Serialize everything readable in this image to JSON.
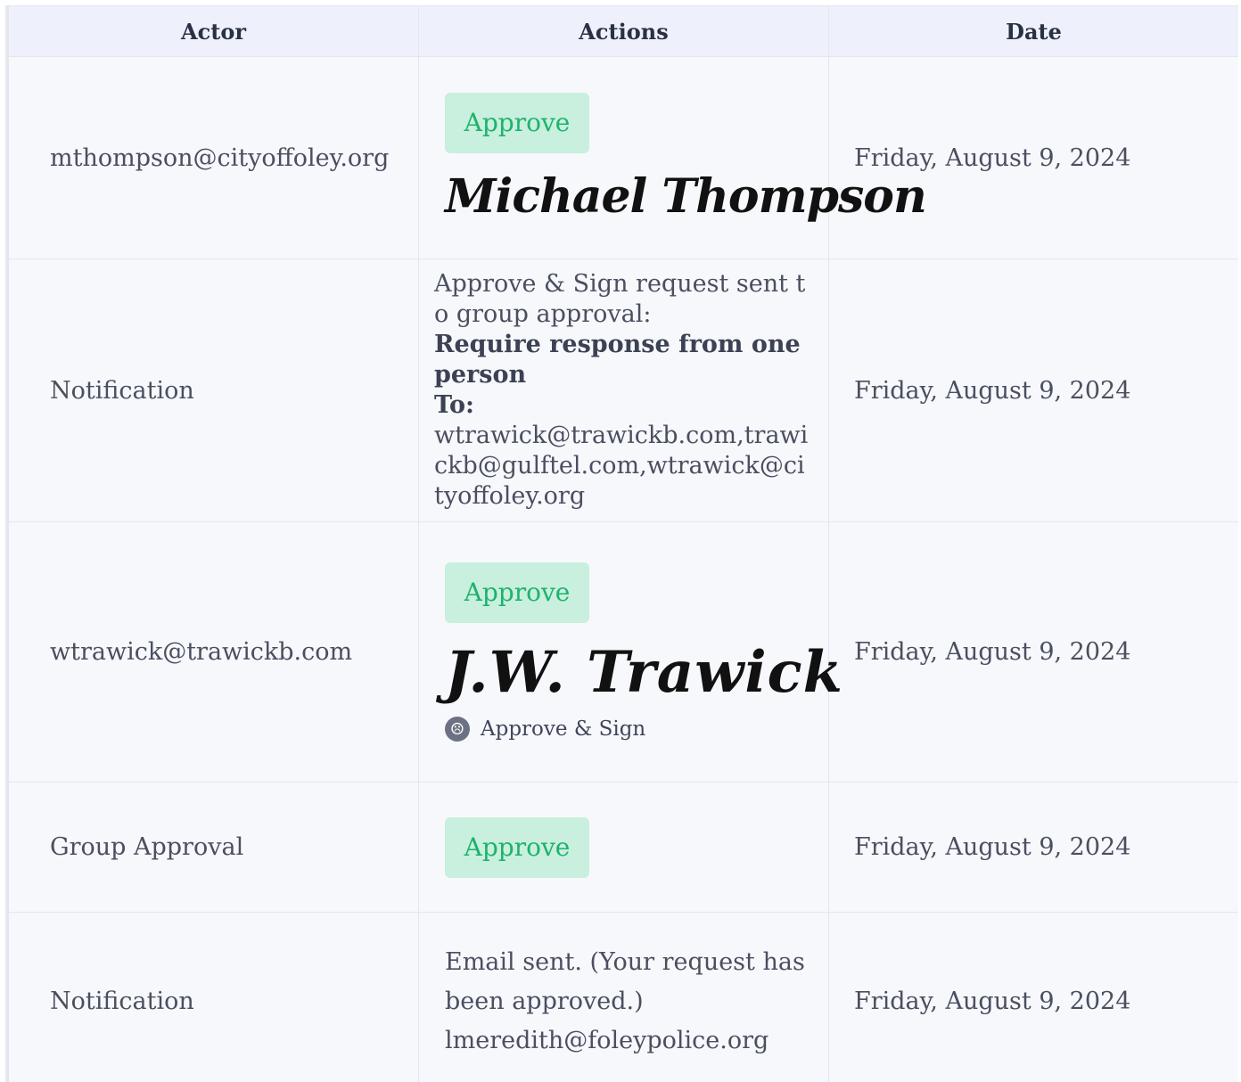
{
  "columns": {
    "actor": "Actor",
    "actions": "Actions",
    "date": "Date"
  },
  "rows": [
    {
      "actor": "mthompson@cityoffoley.org",
      "approve_label": "Approve",
      "signature": "Michael Thompson",
      "date": "Friday, August 9, 2024"
    },
    {
      "actor": "Notification",
      "message_line": "Approve & Sign request sent to group approval:",
      "requirement": "Require response from one person",
      "to_label": "To:",
      "recipients": "wtrawick@trawickb.com,trawickb@gulftel.com,wtrawick@cityoffoley.org",
      "date": "Friday, August 9, 2024"
    },
    {
      "actor": "wtrawick@trawickb.com",
      "approve_label": "Approve",
      "signature": "J.W. Trawick",
      "sub_action": "Approve & Sign",
      "date": "Friday, August 9, 2024"
    },
    {
      "actor": "Group Approval",
      "approve_label": "Approve",
      "date": "Friday, August 9, 2024"
    },
    {
      "actor": "Notification",
      "email_status": "Email sent. (Your request has been approved.)",
      "email_recipient": "lmeredith@foleypolice.org",
      "date": "Friday, August 9, 2024"
    }
  ],
  "icons": {
    "approve_sign_icon": "sad-face-icon"
  },
  "colors": {
    "header_bg": "#eef0fb",
    "approve_bg": "#c9efdf",
    "approve_text": "#1db36b"
  }
}
